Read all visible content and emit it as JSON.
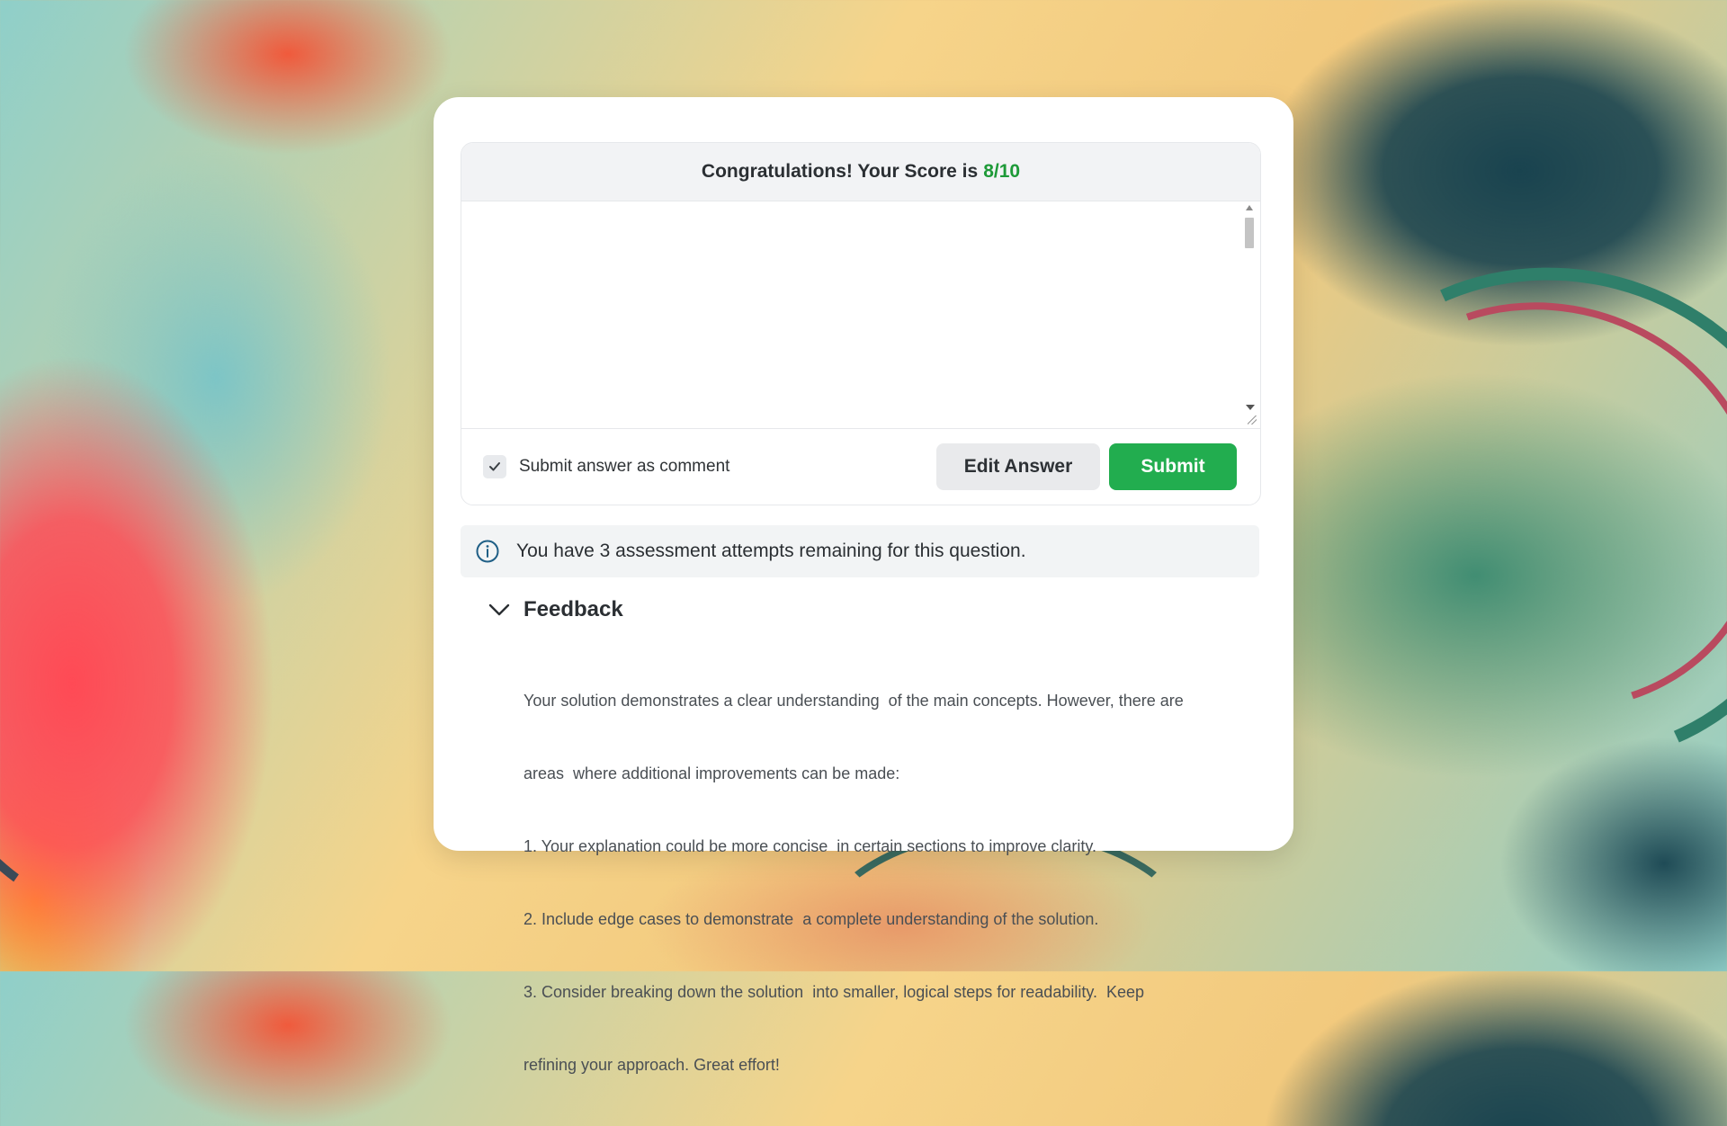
{
  "score": {
    "prefix": "Congratulations! Your Score is",
    "value": "8/10",
    "value_color": "#1e9a38"
  },
  "answer": {
    "value": "",
    "icons": [
      "scroll-up-arrow-icon",
      "scroll-down-arrow-icon",
      "resize-grip-icon"
    ]
  },
  "comment_option": {
    "label": "Submit answer as comment",
    "checked": true,
    "icon": "checkmark-icon"
  },
  "buttons": {
    "edit_label": "Edit Answer",
    "submit_label": "Submit",
    "submit_color": "#22ad4f"
  },
  "info": {
    "icon": "info-circle-icon",
    "text": "You have 3 assessment attempts remaining for this question."
  },
  "feedback": {
    "icon": "chevron-down-icon",
    "title": "Feedback",
    "lines": [
      "Your solution demonstrates a clear understanding  of the main concepts. However, there are",
      "areas  where additional improvements can be made:",
      "1. Your explanation could be more concise  in certain sections to improve clarity.",
      "2. Include edge cases to demonstrate  a complete understanding of the solution.",
      "3. Consider breaking down the solution  into smaller, logical steps for readability.  Keep",
      "refining your approach. Great effort!"
    ]
  }
}
